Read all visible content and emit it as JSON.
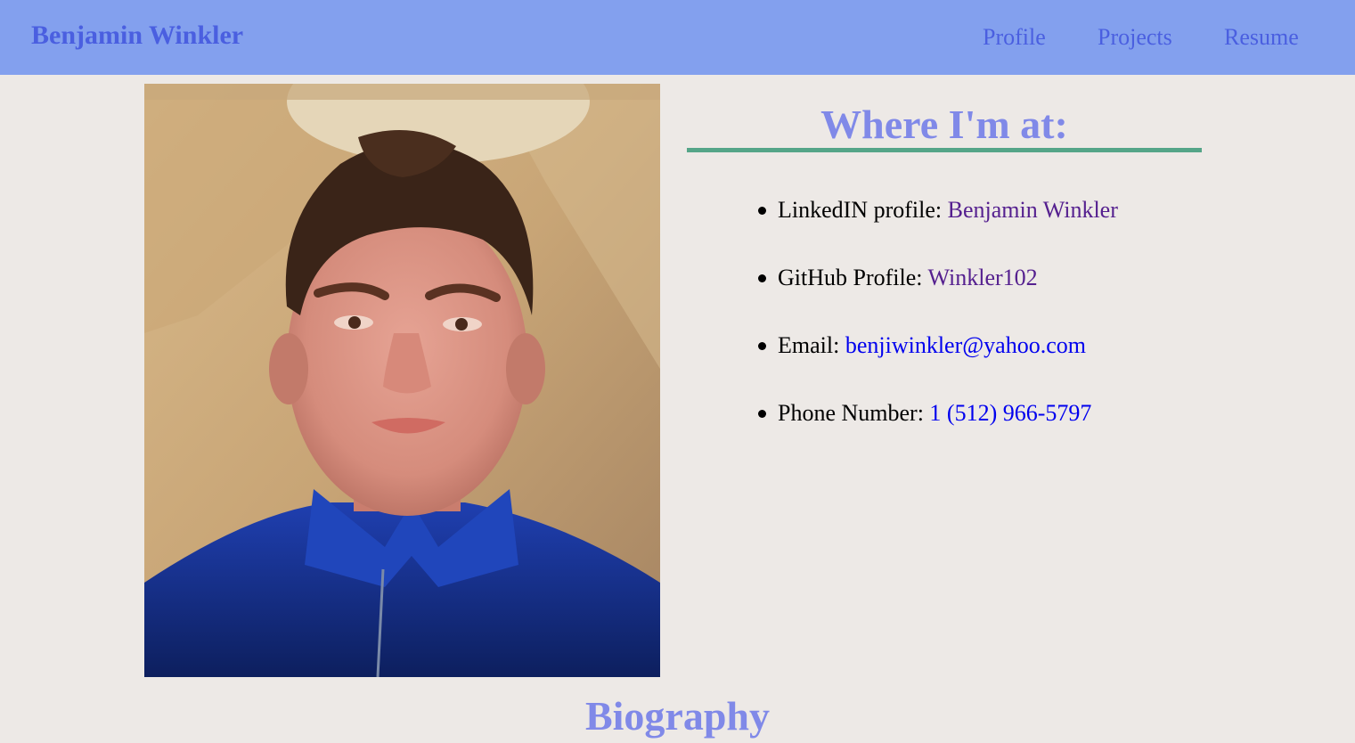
{
  "navbar": {
    "brand": "Benjamin Winkler",
    "links": [
      "Profile",
      "Projects",
      "Resume"
    ]
  },
  "contact": {
    "heading": "Where I'm at:",
    "items": [
      {
        "label": "LinkedIN profile: ",
        "value": "Benjamin Winkler"
      },
      {
        "label": "GitHub Profile: ",
        "value": "Winkler102"
      },
      {
        "label": "Email: ",
        "value": "benjiwinkler@yahoo.com"
      },
      {
        "label": "Phone Number: ",
        "value": "1 (512) 966-5797"
      }
    ]
  },
  "next_section": {
    "heading": "Biography"
  },
  "colors": {
    "navbar_bg": "#83a0ee",
    "page_bg": "#ede9e6",
    "heading": "#8089e8",
    "accent_rule": "#55a588",
    "visited_link": "#55208f",
    "link": "#0000ee"
  }
}
